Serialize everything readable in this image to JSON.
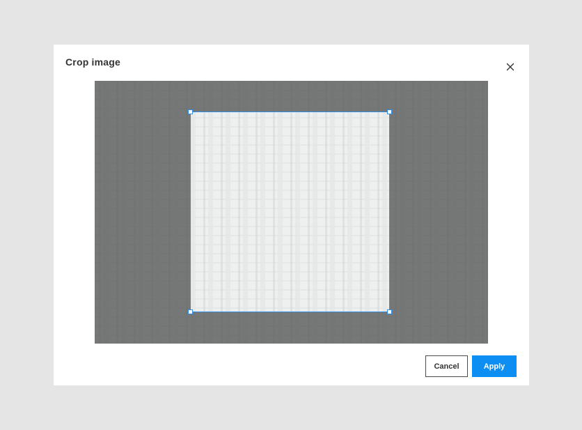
{
  "dialog": {
    "title": "Crop image",
    "close_icon": "close-icon"
  },
  "crop": {
    "selection": {
      "x_start": 0.2425,
      "y_start": 0.1167,
      "x_end": 0.7504,
      "y_end": 0.8806
    },
    "selection_color": "#2f8ee6"
  },
  "actions": {
    "cancel_label": "Cancel",
    "apply_label": "Apply"
  },
  "colors": {
    "accent": "#0d8ef2",
    "backdrop": "#e5e5e5",
    "overlay": "#4b4e4d"
  }
}
